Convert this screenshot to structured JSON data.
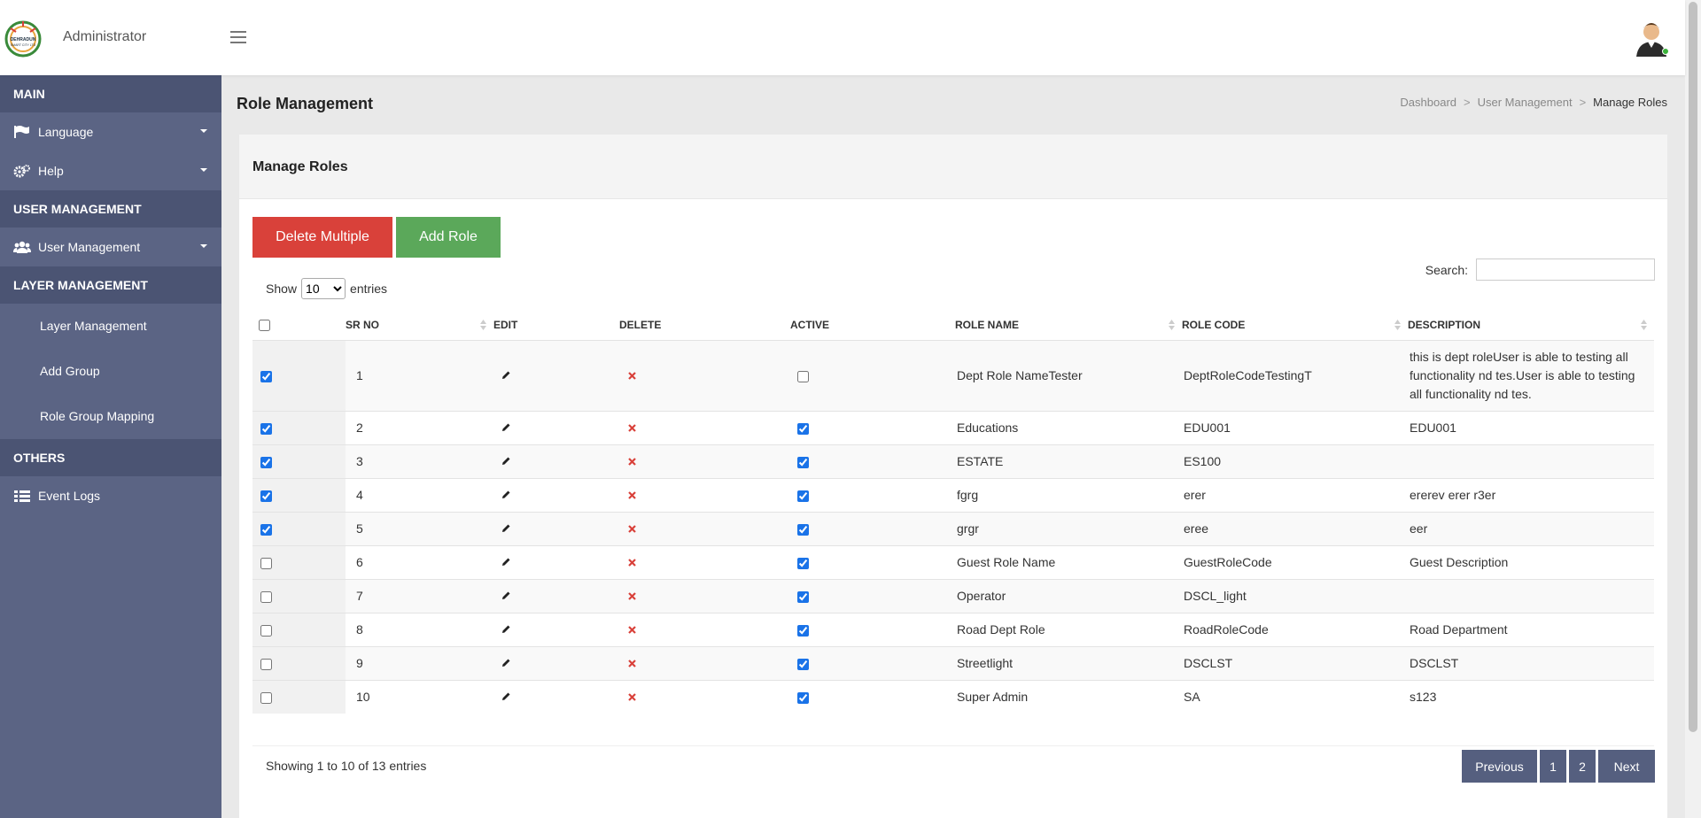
{
  "topbar": {
    "app_title": "Administrator",
    "logo_text": "DEHRADUN SMART CITY LTD"
  },
  "sidebar": {
    "sections": [
      {
        "header": "MAIN"
      },
      {
        "header": "USER MANAGEMENT"
      },
      {
        "header": "LAYER MANAGEMENT"
      },
      {
        "header": "OTHERS"
      }
    ],
    "items": {
      "language": "Language",
      "help": "Help",
      "user_management": "User Management",
      "layer_management": "Layer Management",
      "add_group": "Add Group",
      "role_group_mapping": "Role Group Mapping",
      "event_logs": "Event Logs"
    }
  },
  "page": {
    "title": "Role Management",
    "breadcrumb": [
      "Dashboard",
      "User Management",
      "Manage Roles"
    ],
    "breadcrumb_sep": ">"
  },
  "card": {
    "title": "Manage Roles",
    "delete_multiple": "Delete Multiple",
    "add_role": "Add Role",
    "show_label": "Show",
    "entries_label": "entries",
    "page_size": "10",
    "search_label": "Search:",
    "search_value": "",
    "footer_info": "Showing 1 to 10 of 13 entries"
  },
  "table": {
    "columns": [
      "SR NO",
      "EDIT",
      "DELETE",
      "ACTIVE",
      "ROLE NAME",
      "ROLE CODE",
      "DESCRIPTION"
    ],
    "rows": [
      {
        "sr": "1",
        "selected": true,
        "active": false,
        "role": "Dept Role NameTester",
        "code": "DeptRoleCodeTestingT",
        "desc": "this is dept roleUser is able to testing all functionality nd tes.User is able to testing all functionality nd tes."
      },
      {
        "sr": "2",
        "selected": true,
        "active": true,
        "role": "Educations",
        "code": "EDU001",
        "desc": "EDU001"
      },
      {
        "sr": "3",
        "selected": true,
        "active": true,
        "role": "ESTATE",
        "code": "ES100",
        "desc": ""
      },
      {
        "sr": "4",
        "selected": true,
        "active": true,
        "role": "fgrg",
        "code": "erer",
        "desc": "ererev erer r3er"
      },
      {
        "sr": "5",
        "selected": true,
        "active": true,
        "role": "grgr",
        "code": "eree",
        "desc": "eer"
      },
      {
        "sr": "6",
        "selected": false,
        "active": true,
        "role": "Guest Role Name",
        "code": "GuestRoleCode",
        "desc": "Guest Description"
      },
      {
        "sr": "7",
        "selected": false,
        "active": true,
        "role": "Operator",
        "code": "DSCL_light",
        "desc": ""
      },
      {
        "sr": "8",
        "selected": false,
        "active": true,
        "role": "Road Dept Role",
        "code": "RoadRoleCode",
        "desc": "Road Department"
      },
      {
        "sr": "9",
        "selected": false,
        "active": true,
        "role": "Streetlight",
        "code": "DSCLST",
        "desc": "DSCLST"
      },
      {
        "sr": "10",
        "selected": false,
        "active": true,
        "role": "Super Admin",
        "code": "SA",
        "desc": "s123"
      }
    ]
  },
  "pagination": {
    "previous": "Previous",
    "pages": [
      "1",
      "2"
    ],
    "next": "Next"
  },
  "colors": {
    "sidebar_bg": "#5b6484",
    "sidebar_header_bg": "#4b5473",
    "danger": "#d9413a",
    "success": "#5ba85a",
    "pager_bg": "#555f7f",
    "delete_icon": "#d9413a"
  }
}
